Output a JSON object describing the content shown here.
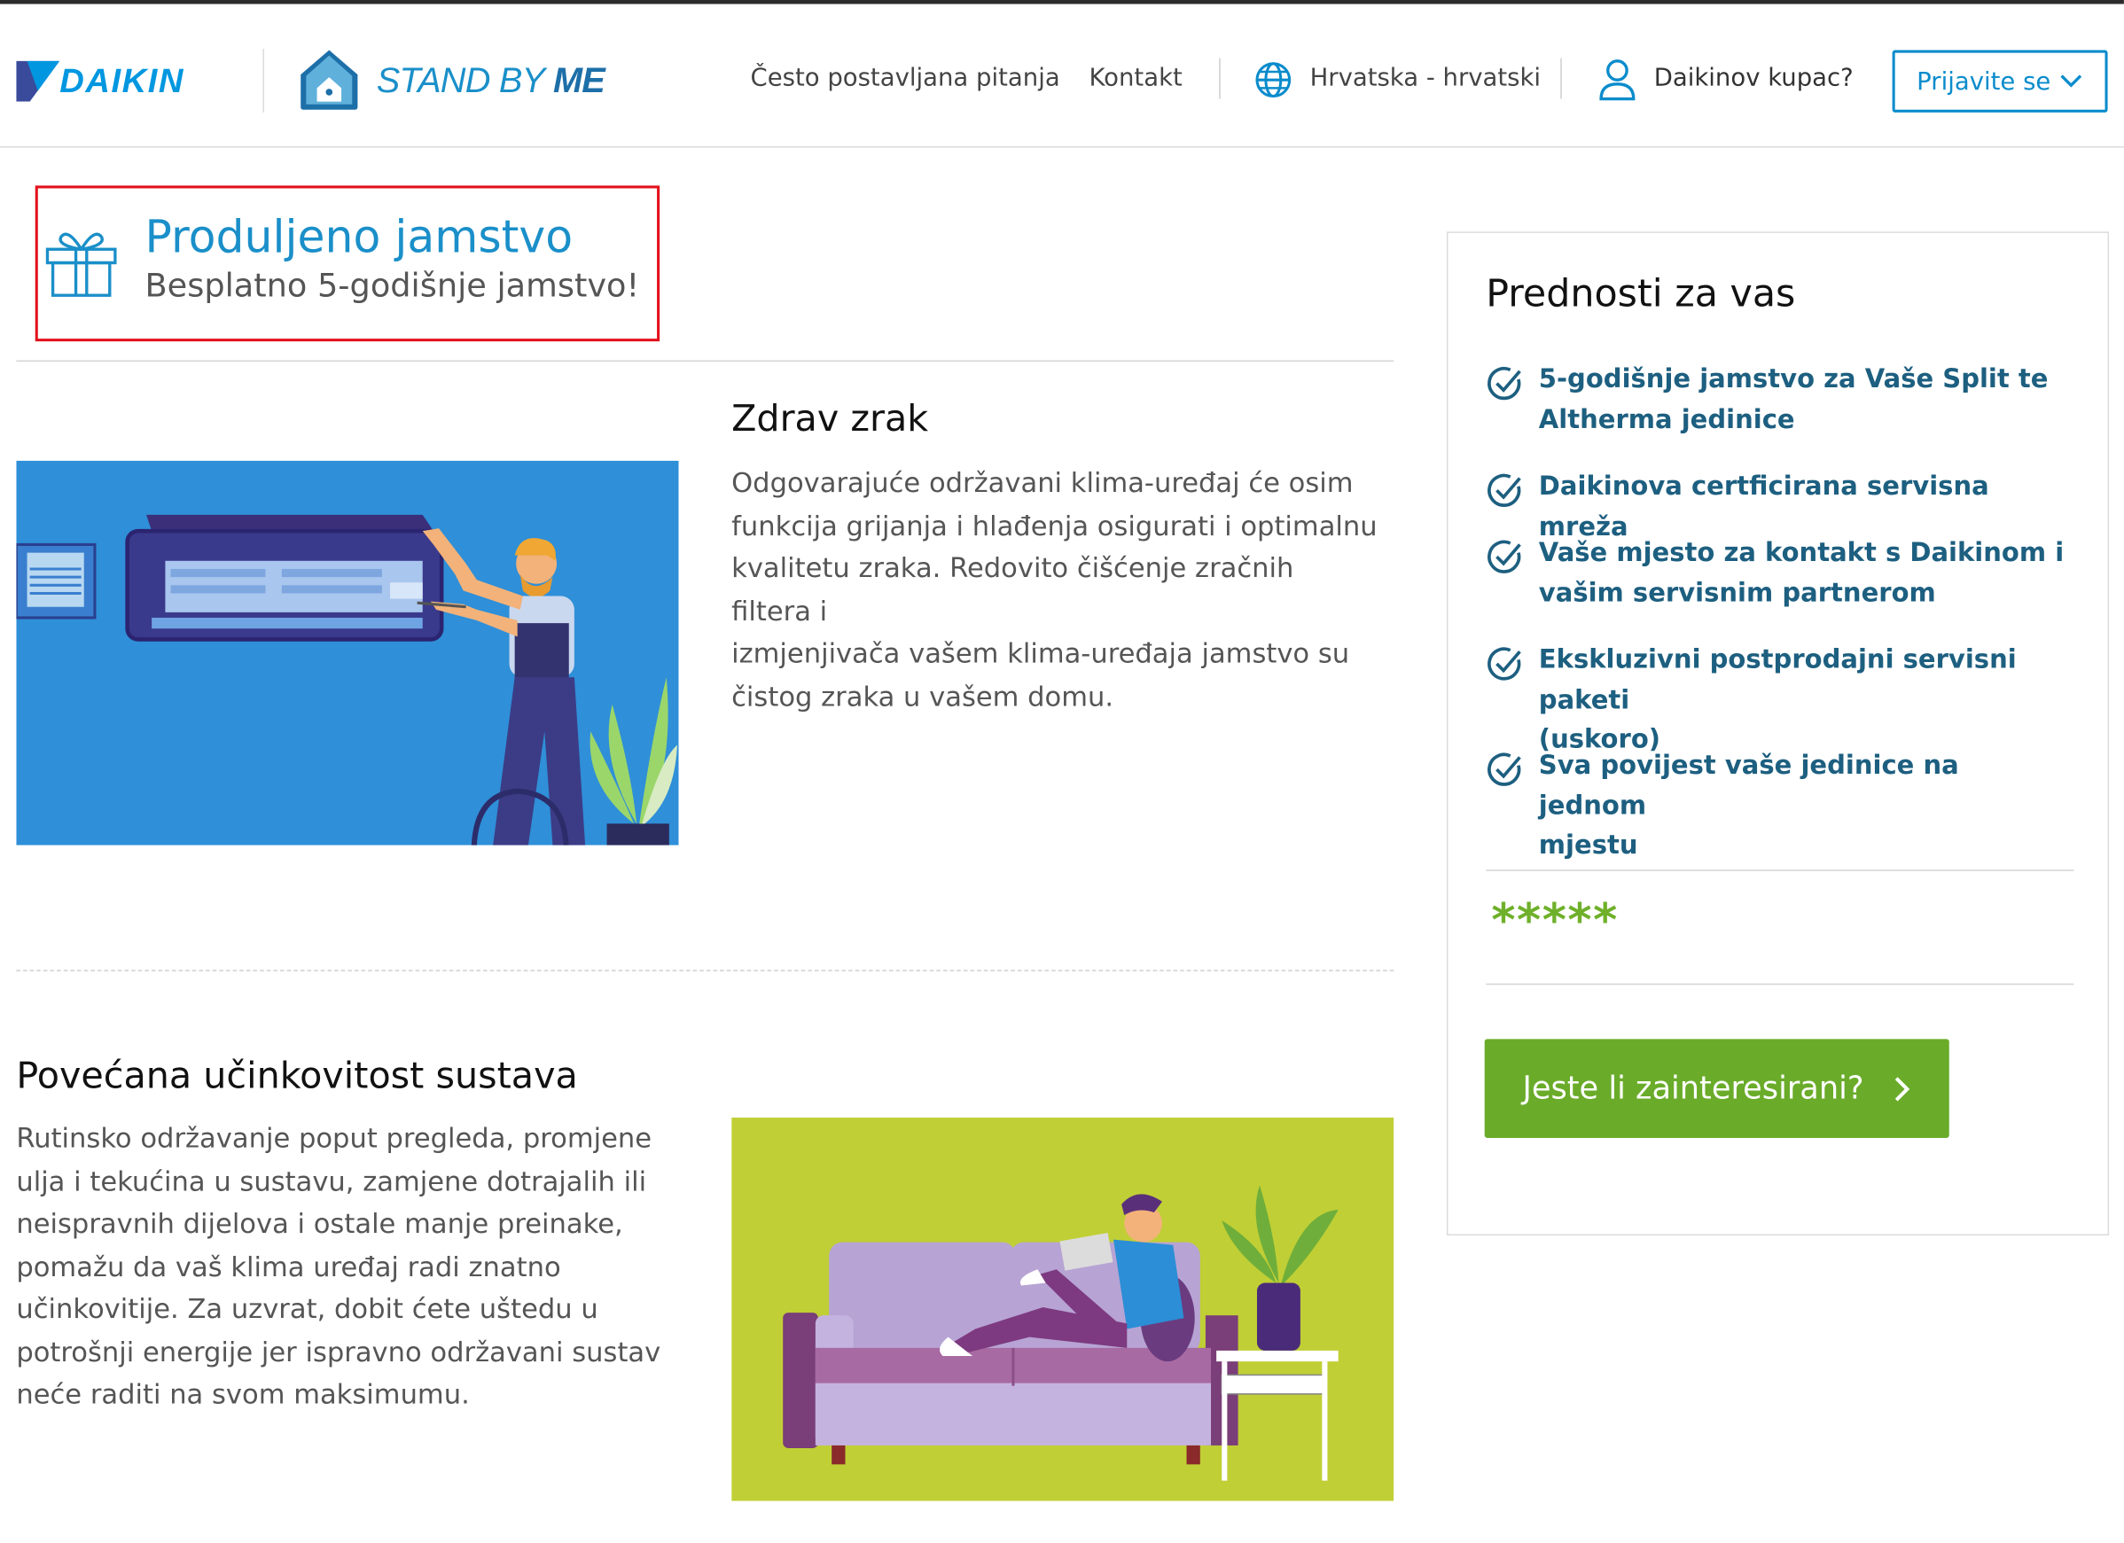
{
  "header": {
    "brand_daikin": "DAIKIN",
    "brand_standby_1": "STAND BY ",
    "brand_standby_2": "ME",
    "nav_faq": "Često postavljana pitanja",
    "nav_contact": "Kontakt",
    "language": "Hrvatska - hrvatski",
    "customer_prompt": "Daikinov kupac?",
    "login_label": "Prijavite se",
    "icons": [
      "globe-icon",
      "user-icon",
      "chevron-down-icon"
    ]
  },
  "promo": {
    "title": "Produljeno jamstvo",
    "subtitle": "Besplatno 5-godišnje jamstvo!",
    "icon": "gift-icon"
  },
  "sections": [
    {
      "title": "Zdrav zrak",
      "body_lines": [
        "Odgovarajuće održavani klima-uređaj će osim",
        "funkcija grijanja i hlađenja osigurati i optimalnu",
        "kvalitetu zraka. Redovito čišćenje zračnih filtera i",
        "izmjenjivača vašem klima-uređaja jamstvo su",
        "čistog zraka u vašem domu."
      ]
    },
    {
      "title": "Povećana učinkovitost sustava",
      "body_lines": [
        "Rutinsko održavanje poput pregleda, promjene",
        "ulja i tekućina u sustavu, zamjene dotrajalih ili",
        "neispravnih dijelova i ostale manje preinake,",
        "pomažu da vaš klima uređaj radi znatno",
        "učinkovitije. Za uzvrat, dobit ćete uštedu u",
        "potrošnji energije jer ispravno održavani sustav",
        "neće raditi na svom maksimumu."
      ]
    }
  ],
  "benefits_card": {
    "title": "Prednosti za vas",
    "items": [
      {
        "line1": "5-godišnje jamstvo za Vaše Split te",
        "line2": "Altherma jedinice"
      },
      {
        "line1": "Daikinova certficirana servisna mreža",
        "line2": ""
      },
      {
        "line1": "Vaše mjesto za kontakt s Daikinom i",
        "line2": "vašim servisnim partnerom"
      },
      {
        "line1": "Ekskluzivni postprodajni servisni paketi",
        "line2": "(uskoro)"
      },
      {
        "line1": "Sva povijest vaše jedinice na jednom",
        "line2": "mjestu"
      }
    ],
    "stars": "*****",
    "cta_label": "Jeste li zainteresirani?"
  },
  "colors": {
    "brand_blue": "#0097e0",
    "link_blue": "#0a8ccc",
    "benefit_text": "#1d5f80",
    "cta_green": "#6aac2a",
    "highlight_red": "#e3101b",
    "image1_bg": "#2f8fd8",
    "image2_bg": "#c0cf35"
  }
}
